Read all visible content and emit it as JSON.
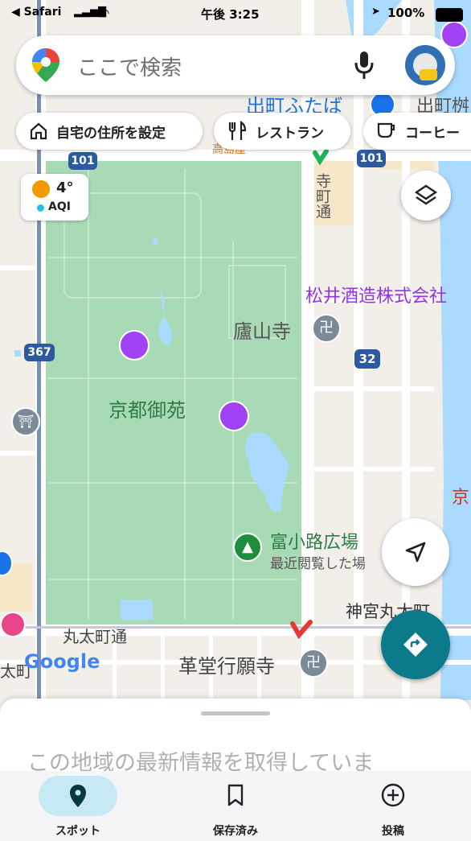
{
  "status_bar": {
    "back_app": "◀ Safari",
    "time": "午後 3:25",
    "battery": "100%"
  },
  "search": {
    "placeholder": "ここで検索"
  },
  "chips": [
    {
      "label": "自宅の住所を設定"
    },
    {
      "label": "レストラン"
    },
    {
      "label": "コーヒー"
    }
  ],
  "weather": {
    "temp": "4°",
    "aqi": "AQI"
  },
  "map_labels": {
    "demachi_futaba": "出町ふたば",
    "demachi": "出町桝",
    "teramachi": "寺町通",
    "matsui_sake": "松井酒造株式会社",
    "rozanji": "廬山寺",
    "kyoto_gyoen": "京都御苑",
    "tominokoji": "富小路広場",
    "recently_viewed": "最近閲覧した場",
    "jingu_marutamachi": "神宮丸太町",
    "marutamachi_dori": "丸太町通",
    "kodo_gyoganji": "革堂行願寺",
    "tamachi": "太町",
    "kyo": "京",
    "koshoin": "高島屋",
    "route_101a": "101",
    "route_101b": "101",
    "route_367": "367",
    "route_32": "32",
    "google": "Google"
  },
  "colors": {
    "park": "#a8dab5",
    "water": "#aadaff",
    "accent": "#0b7a8a",
    "poi_purple": "#a142f4"
  },
  "sheet": {
    "message": "この地域の最新情報を取得していま"
  },
  "tabs": [
    {
      "label": "スポット"
    },
    {
      "label": "保存済み"
    },
    {
      "label": "投稿"
    }
  ]
}
